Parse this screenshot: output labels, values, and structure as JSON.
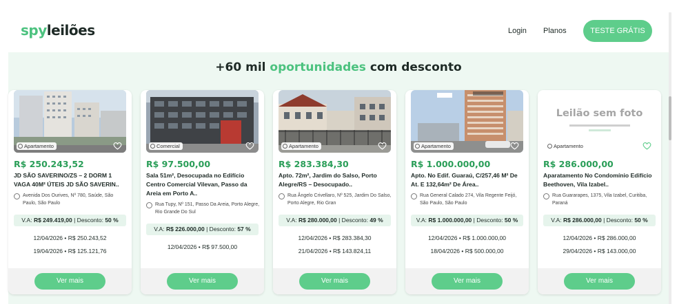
{
  "brand": {
    "logo_part1": "spy",
    "logo_part2": "leilões"
  },
  "nav": {
    "login": "Login",
    "planos": "Planos",
    "cta": "TESTE GRÁTIS"
  },
  "hero": {
    "prefix": "+60 mil ",
    "highlight": "oportunidades",
    "suffix": " com desconto"
  },
  "colors": {
    "accent": "#5ecd8b",
    "price": "#2a9e58",
    "band": "#eef8f2"
  },
  "cards": [
    {
      "type": "Apartamento",
      "price": "R$ 250.243,52",
      "title": "JD SÃO SAVERINO/ZS – 2 DORM 1 VAGA 40M² ÚTEIS JD SÃO SAVERIN..",
      "address": "Avenida Dos Ourives, Nº 780, Saúde, São Paulo, São Paulo",
      "va_label": "V.A:",
      "va_value": "R$ 249.419,00",
      "disc_label": "| Desconto:",
      "disc_value": "50 %",
      "date1": "12/04/2026 • R$ 250.243,52",
      "date2": "19/04/2026 • R$ 125.121,76",
      "button": "Ver mais"
    },
    {
      "type": "Comercial",
      "price": "R$ 97.500,00",
      "title": "Sala 51m², Desocupada no Edifício Centro Comercial Vilevan, Passo da Areia em Porto A..",
      "address": "Rua Tupy, Nº 151, Passo Da Areia, Porto Alegre, Rio Grande Do Sul",
      "va_label": "V.A:",
      "va_value": "R$ 226.000,00",
      "disc_label": "| Desconto:",
      "disc_value": "57 %",
      "date1": "12/04/2026 • R$ 97.500,00",
      "date2": "",
      "button": "Ver mais"
    },
    {
      "type": "Apartamento",
      "price": "R$ 283.384,30",
      "title": "Apto. 72m², Jardim do Salso, Porto Alegre/RS – Desocupado..",
      "address": "Rua Ângelo Crivellaro, Nº 525, Jardim Do Salso, Porto Alegre, Rio Gran",
      "va_label": "V.A:",
      "va_value": "R$ 280.000,00",
      "disc_label": "| Desconto:",
      "disc_value": "49 %",
      "date1": "12/04/2026 • R$ 283.384,30",
      "date2": "21/04/2026 • R$ 143.824,11",
      "button": "Ver mais"
    },
    {
      "type": "Apartamento",
      "price": "R$ 1.000.000,00",
      "title": "Apto. No Edif. Guaraú, C/257,46 M² De At. E 132,64m² De Área..",
      "address": "Rua General Calado 274, Vila Regente Feijó, São Paulo, São Paulo",
      "va_label": "V.A:",
      "va_value": "R$ 1.000.000,00",
      "disc_label": "| Desconto:",
      "disc_value": "50 %",
      "date1": "12/04/2026 • R$ 1.000.000,00",
      "date2": "18/04/2026 • R$ 500.000,00",
      "button": "Ver mais"
    },
    {
      "type": "Apartamento",
      "price": "R$ 286.000,00",
      "title": "Aparatamento No Condomínio Edifício Beethoven, Vila Izabel..",
      "address": "Rua Guararapes, 1375, Vila Izabel, Curitiba, Paraná",
      "va_label": "V.A:",
      "va_value": "R$ 286.000,00",
      "disc_label": "| Desconto:",
      "disc_value": "50 %",
      "date1": "12/04/2026 • R$ 286.000,00",
      "date2": "29/04/2026 • R$ 143.000,00",
      "button": "Ver mais",
      "no_photo": "Leilão sem foto"
    }
  ]
}
